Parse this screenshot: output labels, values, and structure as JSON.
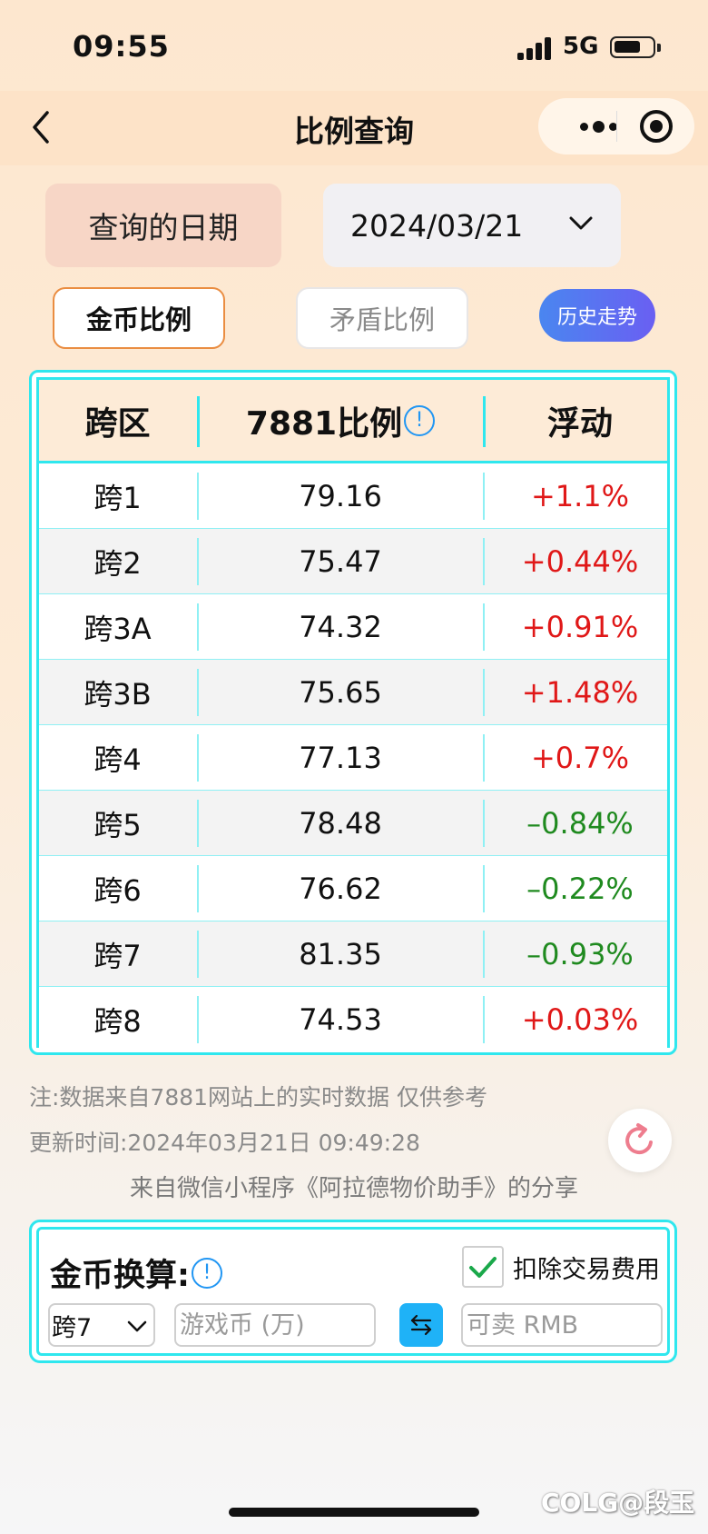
{
  "status_bar": {
    "time": "09:55",
    "network": "5G"
  },
  "nav": {
    "title": "比例查询"
  },
  "date_query": {
    "label": "查询的日期",
    "value": "2024/03/21"
  },
  "tabs": {
    "gold": "金币比例",
    "shield": "矛盾比例"
  },
  "history_button": "历史走势",
  "table": {
    "headers": {
      "server": "跨区",
      "ratio": "7881比例",
      "change": "浮动"
    },
    "info_glyph": "!",
    "rows": [
      {
        "server": "跨1",
        "ratio": "79.16",
        "change": "+1.1%"
      },
      {
        "server": "跨2",
        "ratio": "75.47",
        "change": "+0.44%"
      },
      {
        "server": "跨3A",
        "ratio": "74.32",
        "change": "+0.91%"
      },
      {
        "server": "跨3B",
        "ratio": "75.65",
        "change": "+1.48%"
      },
      {
        "server": "跨4",
        "ratio": "77.13",
        "change": "+0.7%"
      },
      {
        "server": "跨5",
        "ratio": "78.48",
        "change": "–0.84%"
      },
      {
        "server": "跨6",
        "ratio": "76.62",
        "change": "–0.22%"
      },
      {
        "server": "跨7",
        "ratio": "81.35",
        "change": "–0.93%"
      },
      {
        "server": "跨8",
        "ratio": "74.53",
        "change": "+0.03%"
      }
    ]
  },
  "notes": {
    "disclaimer": "注:数据来自7881网站上的实时数据 仅供参考",
    "updated": "更新时间:2024年03月21日 09:49:28",
    "share": "来自微信小程序《阿拉德物价助手》的分享"
  },
  "calculator": {
    "title": "金币换算:",
    "fee_label": "扣除交易费用",
    "fee_checked": true,
    "server_value": "跨7",
    "game_placeholder": "游戏币 (万)",
    "rmb_placeholder": "可卖 RMB"
  },
  "watermark": "COLG@段玉",
  "colors": {
    "accent_cyan": "#2fe7ee",
    "positive": "#e01818",
    "negative": "#1f8a1f",
    "tab_active_border": "#ea8d41"
  }
}
